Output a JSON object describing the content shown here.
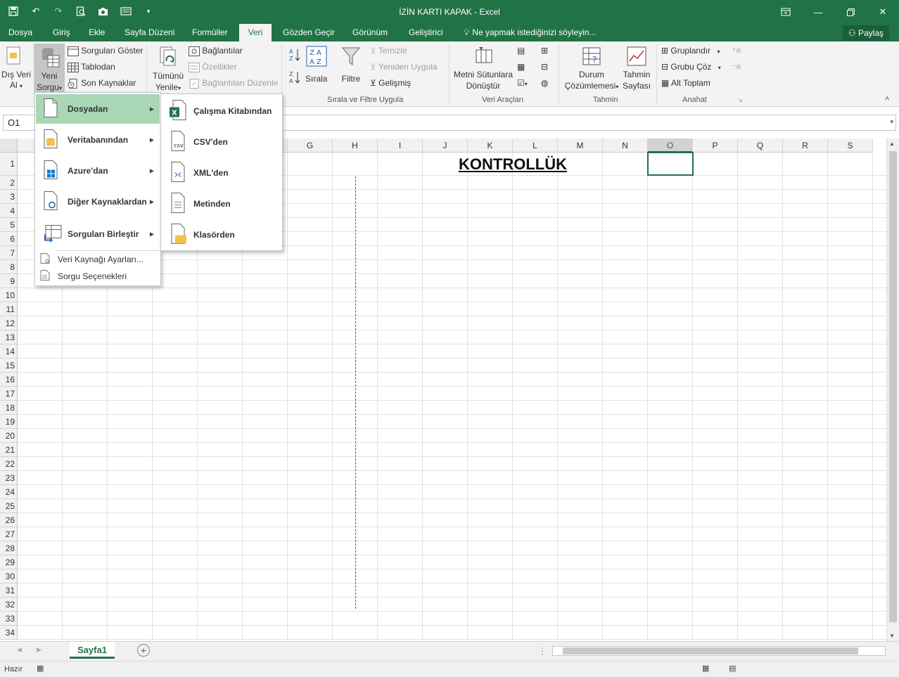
{
  "window": {
    "title": "İZİN KARTI KAPAK - Excel"
  },
  "tabs": [
    "Dosya",
    "Giriş",
    "Ekle",
    "Sayfa Düzeni",
    "Formüller",
    "Veri",
    "Gözden Geçir",
    "Görünüm",
    "Geliştirici"
  ],
  "active_tab": "Veri",
  "tell_me": "Ne yapmak istediğinizi söyleyin...",
  "share_label": "Paylaş",
  "ribbon": {
    "dis_veri": [
      "Dış Veri",
      "Al"
    ],
    "yeni_sorgu": [
      "Yeni",
      "Sorgu"
    ],
    "sorgulari_goster": "Sorguları Göster",
    "tablodan": "Tablodan",
    "son_kaynaklar": "Son Kaynaklar",
    "tumunu_yenile": [
      "Tümünü",
      "Yenile"
    ],
    "baglantilar": "Bağlantılar",
    "ozellikler": "Özellikler",
    "baglantilari_duzenle": "Bağlantıları Düzenle",
    "sirala": "Sırala",
    "filtre": "Filtre",
    "temizle": "Temizle",
    "yeniden_uygula": "Yeniden Uygula",
    "gelismis": "Gelişmiş",
    "sirala_filtre_label": "Sırala ve Filtre Uygula",
    "metni_sutunlara": [
      "Metni Sütunlara",
      "Dönüştür"
    ],
    "veri_araclari_label": "Veri Araçları",
    "durum": [
      "Durum",
      "Çözümlemesi"
    ],
    "tahmin_sayfasi": [
      "Tahmin",
      "Sayfası"
    ],
    "tahmin_label": "Tahmin",
    "gruplandir": "Gruplandır",
    "grubu_coz": "Grubu Çöz",
    "alt_toplam": "Alt Toplam",
    "anahat_label": "Anahat"
  },
  "formula_bar": {
    "name_box": "O1",
    "value": ""
  },
  "columns": [
    "G",
    "H",
    "I",
    "J",
    "K",
    "L",
    "M",
    "N",
    "O",
    "P",
    "Q",
    "R",
    "S"
  ],
  "selected_column": "O",
  "rows": [
    "1",
    "2",
    "3",
    "4",
    "5",
    "6",
    "7",
    "8",
    "9",
    "10",
    "11",
    "12",
    "13",
    "14",
    "15",
    "16",
    "17",
    "18",
    "19",
    "20",
    "21",
    "22",
    "23",
    "24",
    "25",
    "26",
    "27",
    "28",
    "29",
    "30",
    "31",
    "32",
    "33",
    "34"
  ],
  "cells": {
    "title": "KONTROLLÜK"
  },
  "menu_main": {
    "items": [
      "Dosyadan",
      "Veritabanından",
      "Azure'dan",
      "Diğer Kaynaklardan",
      "Sorguları Birleştir"
    ],
    "small_items": [
      "Veri Kaynağı Ayarları...",
      "Sorgu Seçenekleri"
    ]
  },
  "menu_sub": {
    "items": [
      "Çalışma Kitabından",
      "CSV'den",
      "XML'den",
      "Metinden",
      "Klasörden"
    ]
  },
  "sheet_tab": "Sayfa1",
  "status": "Hazır",
  "colors": {
    "excel_green": "#217346",
    "menu_highlight": "#a9d7b6"
  }
}
